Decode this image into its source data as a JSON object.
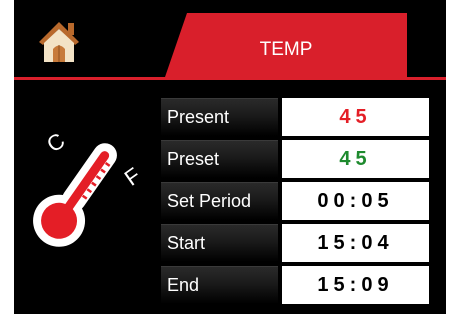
{
  "header": {
    "tab_label": "TEMP",
    "accent_color": "#d91f2b",
    "home_icon": "home-icon"
  },
  "thermometer": {
    "icon": "thermometer-icon",
    "unit_c": "C",
    "unit_f": "F"
  },
  "rows": [
    {
      "label": "Present",
      "value": "45",
      "value_color": "#e41e26"
    },
    {
      "label": "Preset",
      "value": "45",
      "value_color": "#1e8a2e"
    },
    {
      "label": "Set Period",
      "value": "00:05",
      "value_color": "#000000"
    },
    {
      "label": "Start",
      "value": "15:04",
      "value_color": "#000000"
    },
    {
      "label": "End",
      "value": "15:09",
      "value_color": "#000000"
    }
  ]
}
